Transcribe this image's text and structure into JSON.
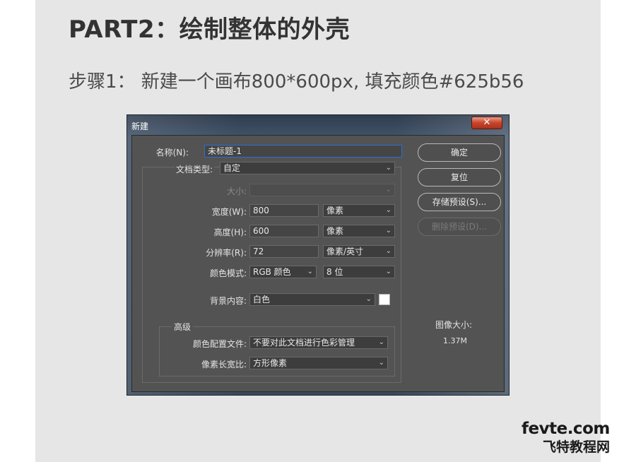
{
  "heading": "PART2：绘制整体的外壳",
  "step": "步骤1：  新建一个画布800*600px, 填充颜色#625b56",
  "dialog": {
    "title": "新建",
    "close_symbol": "✕",
    "fields": {
      "name_label": "名称(N):",
      "name_value": "未标题-1",
      "doc_type_label": "文档类型:",
      "doc_type_value": "自定",
      "size_label": "大小:",
      "size_value": "",
      "width_label": "宽度(W):",
      "width_value": "800",
      "width_unit": "像素",
      "height_label": "高度(H):",
      "height_value": "600",
      "height_unit": "像素",
      "resolution_label": "分辨率(R):",
      "resolution_value": "72",
      "resolution_unit": "像素/英寸",
      "color_mode_label": "颜色模式:",
      "color_mode_value": "RGB 颜色",
      "bit_depth_value": "8 位",
      "background_label": "背景内容:",
      "background_value": "白色",
      "background_swatch_color": "#ffffff"
    },
    "advanced": {
      "legend": "高级",
      "color_profile_label": "颜色配置文件:",
      "color_profile_value": "不要对此文档进行色彩管理",
      "pixel_aspect_label": "像素长宽比:",
      "pixel_aspect_value": "方形像素"
    },
    "buttons": {
      "ok": "确定",
      "reset": "复位",
      "save_preset": "存储预设(S)...",
      "delete_preset": "删除预设(D)..."
    },
    "info": {
      "image_size_label": "图像大小:",
      "image_size_value": "1.37M"
    }
  },
  "watermark": {
    "domain": "fevte.com",
    "name": "飞特教程网"
  },
  "colors": {
    "panel_bg": "#e6e6e6",
    "dialog_bg": "#535353",
    "focus_border": "#2f6fd0"
  }
}
